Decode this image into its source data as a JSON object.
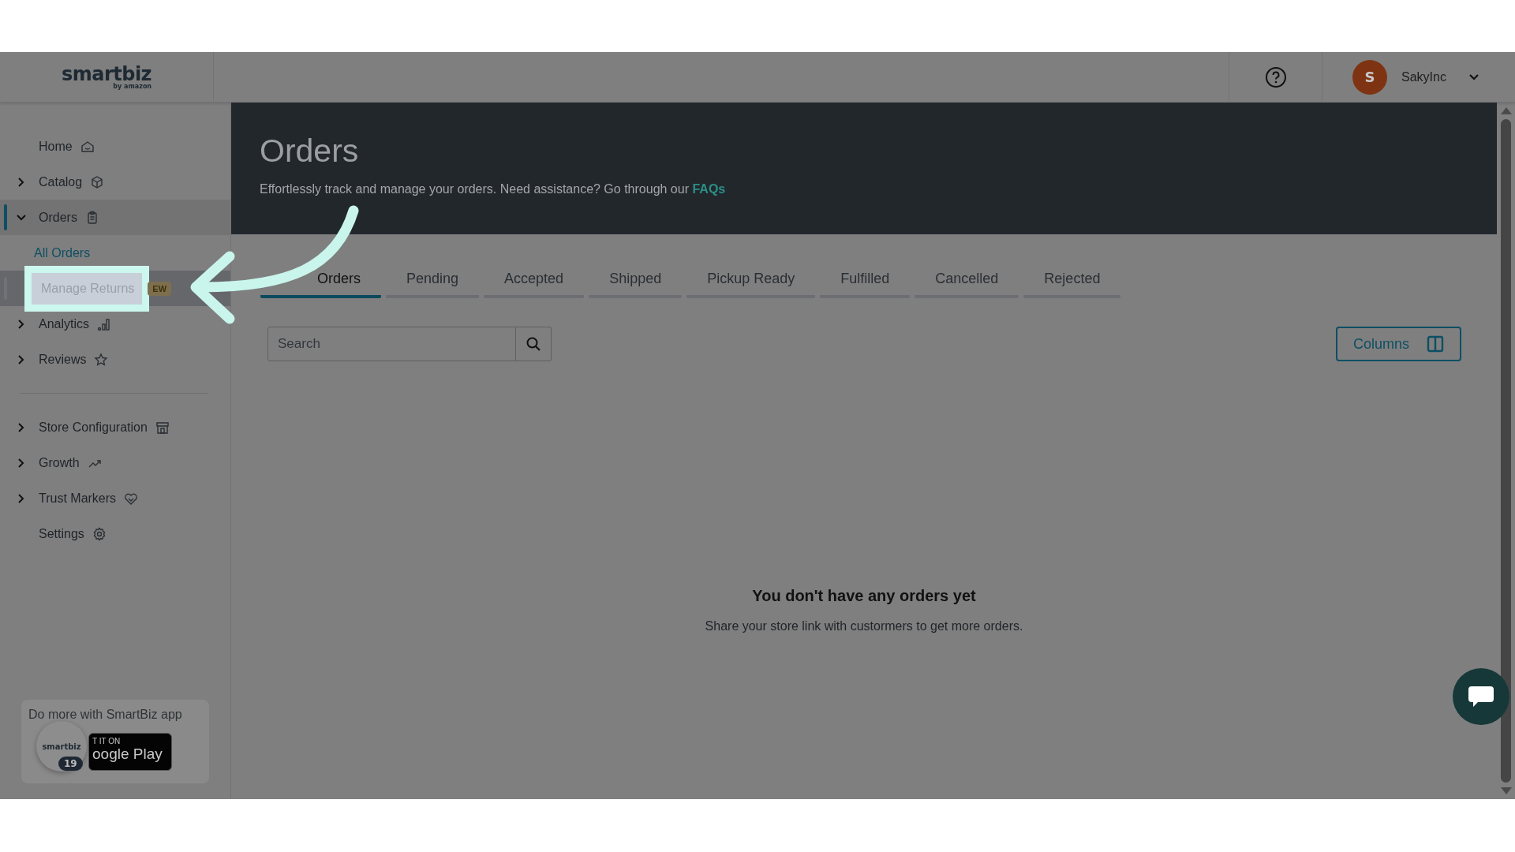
{
  "header": {
    "logo": {
      "wordmark": "smartbiz",
      "tagline": "by amazon"
    },
    "user": {
      "initial": "S",
      "name": "SakyInc"
    }
  },
  "sidebar": {
    "groups": [
      {
        "items": [
          {
            "label": "Home",
            "selected": false
          },
          {
            "label": "Catalog",
            "selected": false,
            "expanded": false
          },
          {
            "label": "Orders",
            "selected": true,
            "expanded": true,
            "children": [
              {
                "label": "All Orders",
                "selected": true,
                "highlighted": false
              },
              {
                "label": "Manage Returns",
                "selected": false,
                "highlighted": true,
                "badge": "EW"
              }
            ]
          },
          {
            "label": "Analytics",
            "selected": false,
            "expanded": false
          },
          {
            "label": "Reviews",
            "selected": false,
            "expanded": false
          }
        ]
      },
      {
        "items": [
          {
            "label": "Store Configuration",
            "selected": false,
            "expanded": false
          },
          {
            "label": "Growth",
            "selected": false,
            "expanded": false
          },
          {
            "label": "Trust Markers",
            "selected": false,
            "expanded": false
          },
          {
            "label": "Settings",
            "selected": false
          }
        ]
      }
    ],
    "promo": {
      "text": "Do more with SmartBiz app",
      "badge_line_1": "T IT ON",
      "badge_line_2": "oogle Play",
      "app_logo": "smartbiz",
      "count": "19"
    }
  },
  "banner": {
    "title": "Orders",
    "subtitle": "Effortlessly track and manage your orders. Need assistance? Go through our",
    "link": "FAQs"
  },
  "tabs": [
    {
      "label": "Orders",
      "selected": true
    },
    {
      "label": "Pending",
      "selected": false
    },
    {
      "label": "Accepted",
      "selected": false
    },
    {
      "label": "Shipped",
      "selected": false
    },
    {
      "label": "Pickup Ready",
      "selected": false
    },
    {
      "label": "Fulfilled",
      "selected": false
    },
    {
      "label": "Cancelled",
      "selected": false
    },
    {
      "label": "Rejected",
      "selected": false
    }
  ],
  "search": {
    "placeholder": "Search"
  },
  "columns_button": {
    "label": "Columns"
  },
  "empty_state": {
    "title": "You don't have any orders yet",
    "message": "Share your store link with custormers to get more orders."
  }
}
